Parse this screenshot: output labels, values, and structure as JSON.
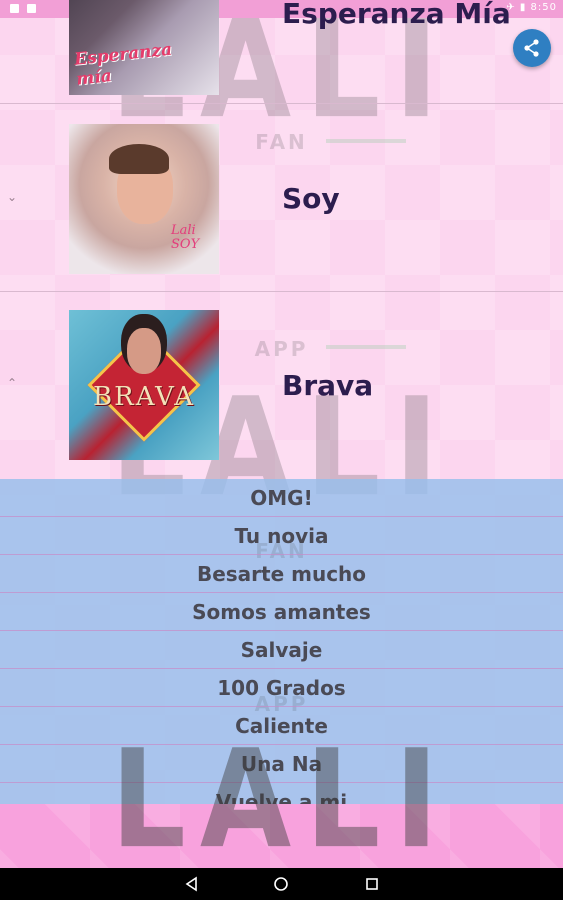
{
  "status_bar": {
    "time": "8:50"
  },
  "watermark": {
    "main": "LALI",
    "fan": "FAN",
    "app": "APP"
  },
  "albums": [
    {
      "title": "Esperanza Mía",
      "cover_text": "Esperanza mía"
    },
    {
      "title": "Soy",
      "cover_text": "Lali SOY"
    },
    {
      "title": "Brava",
      "cover_text": "BRAVA"
    }
  ],
  "songs": [
    "OMG!",
    "Tu novia",
    "Besarte mucho",
    "Somos amantes",
    "Salvaje",
    "100 Grados",
    "Caliente",
    "Una Na",
    "Vuelve a mi"
  ],
  "colors": {
    "status_bar": "#f29fd6",
    "fab": "#2f7fc2",
    "song_panel": "#96bee9",
    "title": "#2c1d4e"
  }
}
